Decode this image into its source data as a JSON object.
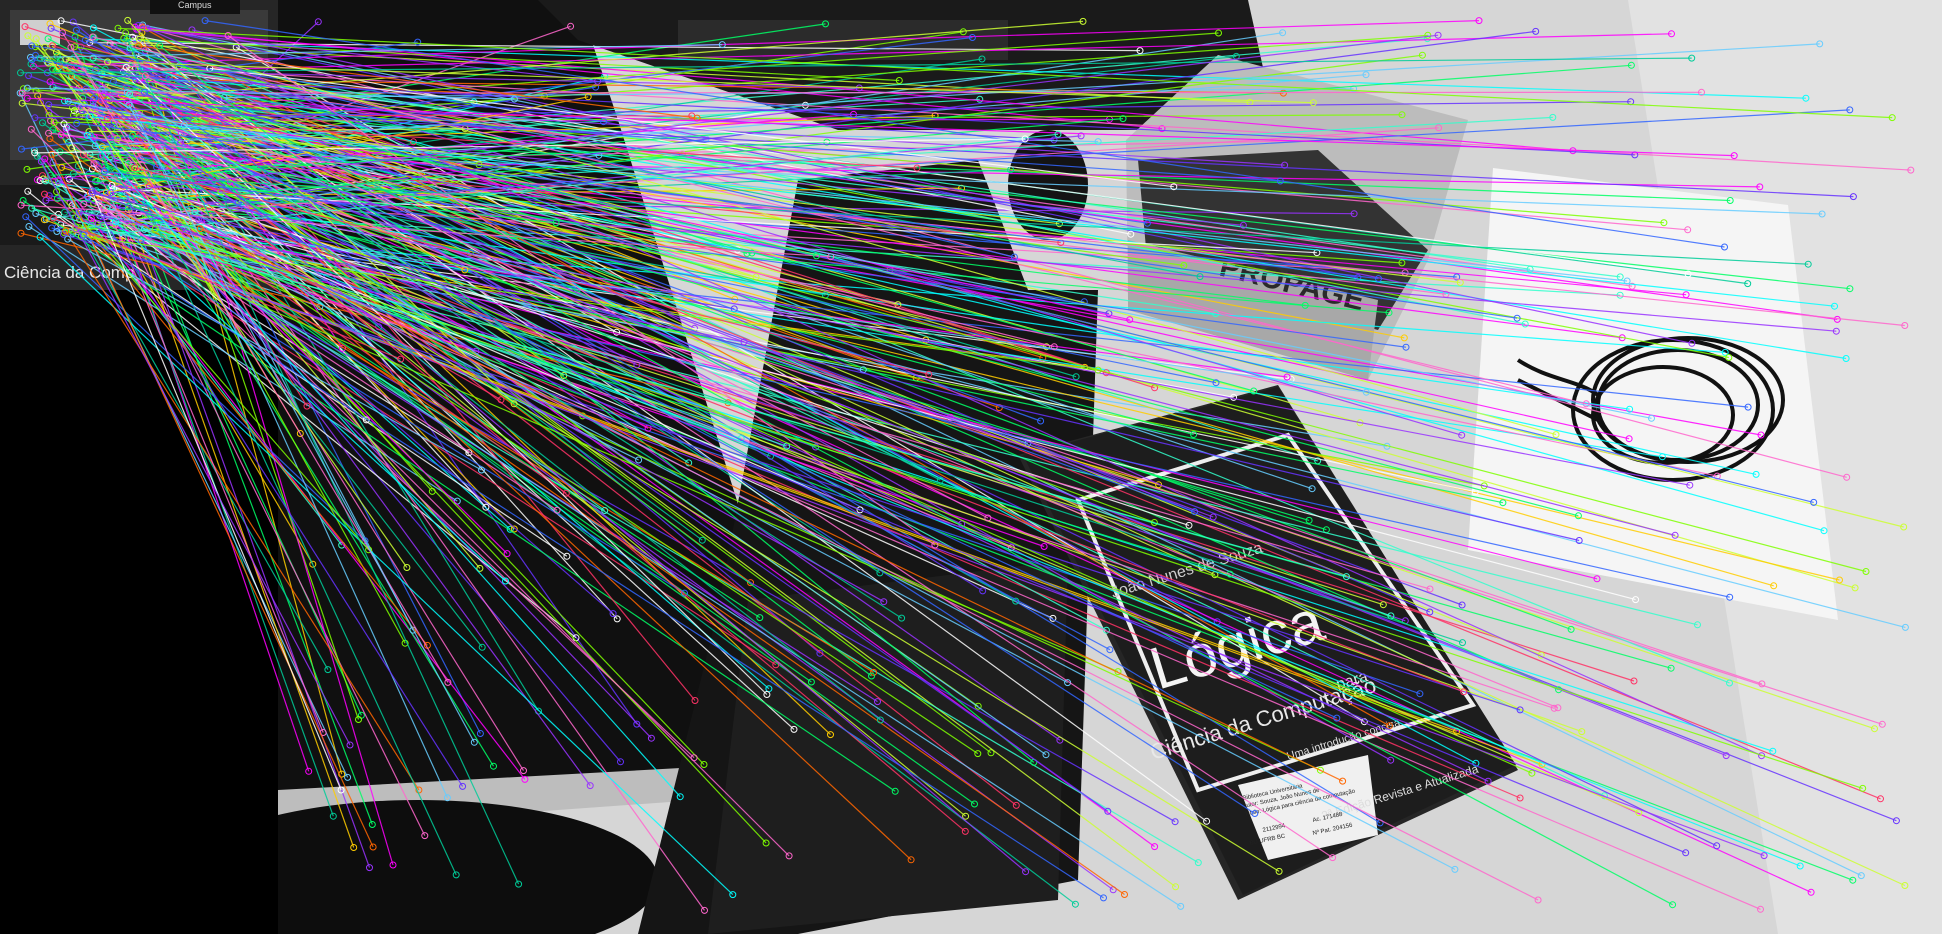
{
  "thumbnail": {
    "caption": "Ciência da Comp",
    "corner_tag": "Campus"
  },
  "scene": {
    "book": {
      "author": "João Nunes de Souza",
      "title": "Lógica",
      "para": "para",
      "subtitle": "Ciência da Computação",
      "tagline": "Uma introdução concisa",
      "edition": "2ª Edição Revista e Atualizada"
    },
    "library_label": {
      "line1": "Biblioteca Universitária",
      "line2": "Autor: Souza, João Nunes de",
      "line3": "Título: Lógica para ciência da computação",
      "line4": "2112994",
      "line5": "Ac. 171488",
      "line6": "BU UFRB BC",
      "line7": "Nº Pat. 204156"
    },
    "box_print": "PROPAGE"
  },
  "match_colors": [
    "#ff00ff",
    "#00ff66",
    "#7fff00",
    "#00ffff",
    "#3366ff",
    "#ff3366",
    "#ffcc00",
    "#9933ff",
    "#33ffcc",
    "#ff6600",
    "#66ccff",
    "#ccff33",
    "#ff66cc",
    "#6633ff",
    "#ffffff",
    "#00cc99"
  ]
}
